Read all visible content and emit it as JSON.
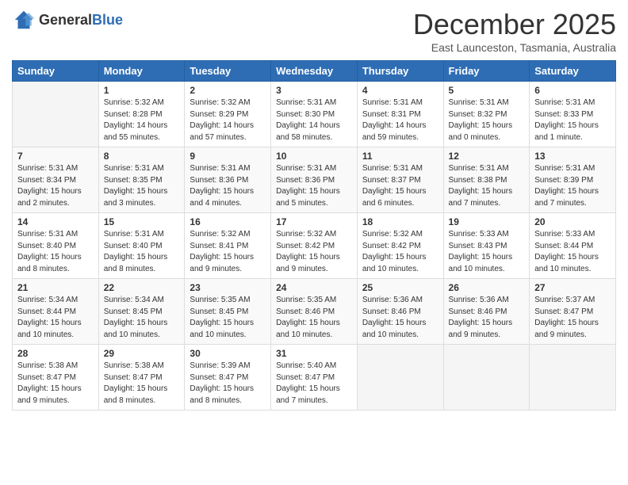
{
  "logo": {
    "general": "General",
    "blue": "Blue"
  },
  "title": "December 2025",
  "subtitle": "East Launceston, Tasmania, Australia",
  "days_of_week": [
    "Sunday",
    "Monday",
    "Tuesday",
    "Wednesday",
    "Thursday",
    "Friday",
    "Saturday"
  ],
  "weeks": [
    [
      {
        "day": "",
        "info": ""
      },
      {
        "day": "1",
        "info": "Sunrise: 5:32 AM\nSunset: 8:28 PM\nDaylight: 14 hours\nand 55 minutes."
      },
      {
        "day": "2",
        "info": "Sunrise: 5:32 AM\nSunset: 8:29 PM\nDaylight: 14 hours\nand 57 minutes."
      },
      {
        "day": "3",
        "info": "Sunrise: 5:31 AM\nSunset: 8:30 PM\nDaylight: 14 hours\nand 58 minutes."
      },
      {
        "day": "4",
        "info": "Sunrise: 5:31 AM\nSunset: 8:31 PM\nDaylight: 14 hours\nand 59 minutes."
      },
      {
        "day": "5",
        "info": "Sunrise: 5:31 AM\nSunset: 8:32 PM\nDaylight: 15 hours\nand 0 minutes."
      },
      {
        "day": "6",
        "info": "Sunrise: 5:31 AM\nSunset: 8:33 PM\nDaylight: 15 hours\nand 1 minute."
      }
    ],
    [
      {
        "day": "7",
        "info": "Sunrise: 5:31 AM\nSunset: 8:34 PM\nDaylight: 15 hours\nand 2 minutes."
      },
      {
        "day": "8",
        "info": "Sunrise: 5:31 AM\nSunset: 8:35 PM\nDaylight: 15 hours\nand 3 minutes."
      },
      {
        "day": "9",
        "info": "Sunrise: 5:31 AM\nSunset: 8:36 PM\nDaylight: 15 hours\nand 4 minutes."
      },
      {
        "day": "10",
        "info": "Sunrise: 5:31 AM\nSunset: 8:36 PM\nDaylight: 15 hours\nand 5 minutes."
      },
      {
        "day": "11",
        "info": "Sunrise: 5:31 AM\nSunset: 8:37 PM\nDaylight: 15 hours\nand 6 minutes."
      },
      {
        "day": "12",
        "info": "Sunrise: 5:31 AM\nSunset: 8:38 PM\nDaylight: 15 hours\nand 7 minutes."
      },
      {
        "day": "13",
        "info": "Sunrise: 5:31 AM\nSunset: 8:39 PM\nDaylight: 15 hours\nand 7 minutes."
      }
    ],
    [
      {
        "day": "14",
        "info": "Sunrise: 5:31 AM\nSunset: 8:40 PM\nDaylight: 15 hours\nand 8 minutes."
      },
      {
        "day": "15",
        "info": "Sunrise: 5:31 AM\nSunset: 8:40 PM\nDaylight: 15 hours\nand 8 minutes."
      },
      {
        "day": "16",
        "info": "Sunrise: 5:32 AM\nSunset: 8:41 PM\nDaylight: 15 hours\nand 9 minutes."
      },
      {
        "day": "17",
        "info": "Sunrise: 5:32 AM\nSunset: 8:42 PM\nDaylight: 15 hours\nand 9 minutes."
      },
      {
        "day": "18",
        "info": "Sunrise: 5:32 AM\nSunset: 8:42 PM\nDaylight: 15 hours\nand 10 minutes."
      },
      {
        "day": "19",
        "info": "Sunrise: 5:33 AM\nSunset: 8:43 PM\nDaylight: 15 hours\nand 10 minutes."
      },
      {
        "day": "20",
        "info": "Sunrise: 5:33 AM\nSunset: 8:44 PM\nDaylight: 15 hours\nand 10 minutes."
      }
    ],
    [
      {
        "day": "21",
        "info": "Sunrise: 5:34 AM\nSunset: 8:44 PM\nDaylight: 15 hours\nand 10 minutes."
      },
      {
        "day": "22",
        "info": "Sunrise: 5:34 AM\nSunset: 8:45 PM\nDaylight: 15 hours\nand 10 minutes."
      },
      {
        "day": "23",
        "info": "Sunrise: 5:35 AM\nSunset: 8:45 PM\nDaylight: 15 hours\nand 10 minutes."
      },
      {
        "day": "24",
        "info": "Sunrise: 5:35 AM\nSunset: 8:46 PM\nDaylight: 15 hours\nand 10 minutes."
      },
      {
        "day": "25",
        "info": "Sunrise: 5:36 AM\nSunset: 8:46 PM\nDaylight: 15 hours\nand 10 minutes."
      },
      {
        "day": "26",
        "info": "Sunrise: 5:36 AM\nSunset: 8:46 PM\nDaylight: 15 hours\nand 9 minutes."
      },
      {
        "day": "27",
        "info": "Sunrise: 5:37 AM\nSunset: 8:47 PM\nDaylight: 15 hours\nand 9 minutes."
      }
    ],
    [
      {
        "day": "28",
        "info": "Sunrise: 5:38 AM\nSunset: 8:47 PM\nDaylight: 15 hours\nand 9 minutes."
      },
      {
        "day": "29",
        "info": "Sunrise: 5:38 AM\nSunset: 8:47 PM\nDaylight: 15 hours\nand 8 minutes."
      },
      {
        "day": "30",
        "info": "Sunrise: 5:39 AM\nSunset: 8:47 PM\nDaylight: 15 hours\nand 8 minutes."
      },
      {
        "day": "31",
        "info": "Sunrise: 5:40 AM\nSunset: 8:47 PM\nDaylight: 15 hours\nand 7 minutes."
      },
      {
        "day": "",
        "info": ""
      },
      {
        "day": "",
        "info": ""
      },
      {
        "day": "",
        "info": ""
      }
    ]
  ]
}
